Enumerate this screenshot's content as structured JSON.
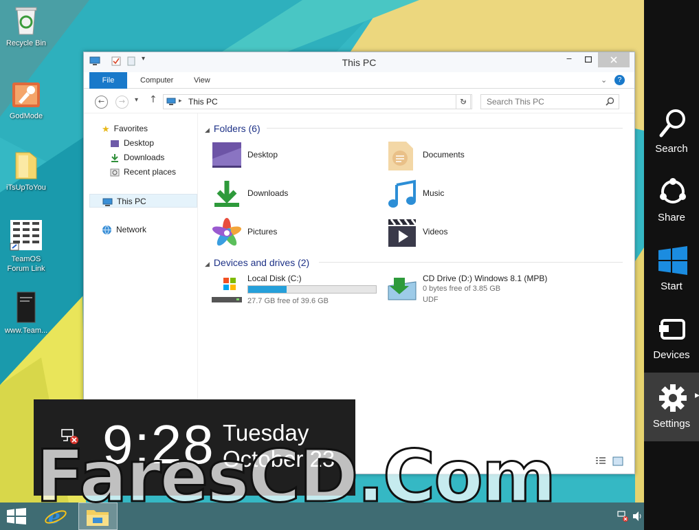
{
  "desktop": {
    "icons": [
      {
        "label": "Recycle Bin",
        "icon": "recycle-bin-icon"
      },
      {
        "label": "GodMode",
        "icon": "godmode-icon"
      },
      {
        "label": "iTsUpToYou",
        "icon": "folder-icon"
      },
      {
        "label": "TeamOS Forum Link",
        "icon": "shortcut-icon"
      },
      {
        "label": "www.Team...",
        "icon": "document-icon"
      }
    ]
  },
  "window": {
    "title": "This PC",
    "ribbon_tabs": [
      "File",
      "Computer",
      "View"
    ],
    "address_path": "This PC",
    "search_placeholder": "Search This PC",
    "nav": {
      "favorites_label": "Favorites",
      "favorites": [
        "Desktop",
        "Downloads",
        "Recent places"
      ],
      "this_pc_label": "This PC",
      "network_label": "Network"
    },
    "folders_header": "Folders (6)",
    "folders": [
      {
        "label": "Desktop",
        "icon": "desktop-folder-icon"
      },
      {
        "label": "Documents",
        "icon": "documents-folder-icon"
      },
      {
        "label": "Downloads",
        "icon": "downloads-folder-icon"
      },
      {
        "label": "Music",
        "icon": "music-folder-icon"
      },
      {
        "label": "Pictures",
        "icon": "pictures-folder-icon"
      },
      {
        "label": "Videos",
        "icon": "videos-folder-icon"
      }
    ],
    "drives_header": "Devices and drives (2)",
    "drives": [
      {
        "name": "Local Disk (C:)",
        "free": "27.7 GB free of 39.6 GB",
        "used_fraction": 0.3,
        "icon": "local-disk-icon"
      },
      {
        "name": "CD Drive (D:) Windows 8.1 (MPB)",
        "free": "0 bytes free of 3.85 GB",
        "fs": "UDF",
        "icon": "cd-drive-icon"
      }
    ]
  },
  "clock": {
    "time": "9:28",
    "day": "Tuesday",
    "date": "October 23"
  },
  "watermark": "FaresCD.Com",
  "charms": [
    "Search",
    "Share",
    "Start",
    "Devices",
    "Settings"
  ],
  "colors": {
    "file_tab": "#1979ca",
    "folders_header": "#1e3287",
    "drive_fill": "#26a0da",
    "charms_bg": "#111111",
    "taskbar": "#3f6c73"
  }
}
